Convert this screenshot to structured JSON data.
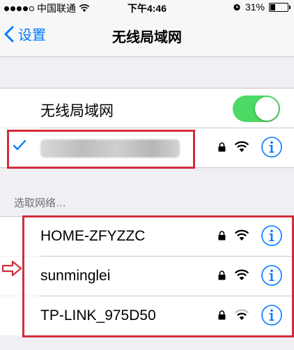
{
  "status_bar": {
    "carrier": "中国联通",
    "time": "下午4:46",
    "battery": "31%",
    "battery_level": 0.31
  },
  "nav": {
    "back_label": "设置",
    "title": "无线局域网"
  },
  "wifi_toggle": {
    "label": "无线局域网",
    "on": true
  },
  "section_header": "选取网络…",
  "networks": [
    {
      "name": "HOME-ZFYZZC",
      "secured": true,
      "signal": "full"
    },
    {
      "name": "sunminglei",
      "secured": true,
      "signal": "full"
    },
    {
      "name": "TP-LINK_975D50",
      "secured": true,
      "signal": "weak"
    }
  ],
  "colors": {
    "accent": "#007aff",
    "toggle_on": "#4cd964",
    "annotation": "#d22d3a"
  },
  "icons": [
    "signal-dots-icon",
    "wifi-status-icon",
    "alarm-icon",
    "battery-icon",
    "back-chevron-icon",
    "checkmark-icon",
    "lock-icon",
    "wifi-icon",
    "info-icon",
    "arrow-right-icon"
  ]
}
